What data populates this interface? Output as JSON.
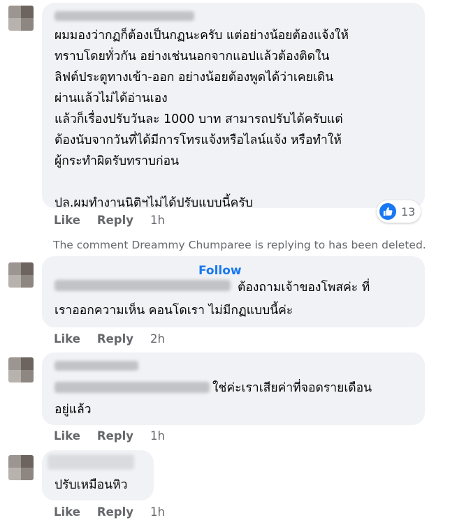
{
  "comments": [
    {
      "text": "ผมมองว่ากฏก็ต้องเป็นกฏนะครับ แต่อย่างน้อยต้องแจ้งให้\nทราบโดยทั่วกัน อย่างเช่นนอกจากแอปแล้วต้องติดใน\nลิฟต์ประตูทางเข้า-ออก อย่างน้อยต้องพูดได้ว่าเคยเดิน\nผ่านแล้วไม่ได้อ่านเอง\nแล้วก็เรื่องปรับวันละ 1000 บาท สามารถปรับได้ครับแต่\nต้องนับจากวันที่ได้มีการโทรแจ้งหรือไลน์แจ้ง หรือทำให้\nผู้กระทำผิดรับทราบก่อน\n\nปล.ผมทำงานนิติฯไม่ได้ปรับแบบนี้ครับ",
      "like_label": "Like",
      "reply_label": "Reply",
      "time": "1h",
      "reaction_count": "13"
    },
    {
      "follow_label": "Follow",
      "text_line1": "ต้องถามเจ้าของโพสค่ะ ที่",
      "text_line2": "เราออกความเห็น คอนโดเรา ไม่มีกฏแบบนี้ค่ะ",
      "like_label": "Like",
      "reply_label": "Reply",
      "time": "2h"
    },
    {
      "text_line1": "ใช่ค่ะเราเสียค่าที่จอดรายเดือน",
      "text_line2": "อยู่แล้ว",
      "like_label": "Like",
      "reply_label": "Reply",
      "time": "1h"
    },
    {
      "text": "ปรับเหมือนหิว",
      "like_label": "Like",
      "reply_label": "Reply",
      "time": "1h"
    }
  ],
  "deleted_note": "The comment Dreammy Chumparee is replying to has been deleted.",
  "colors": {
    "bubble": "#f0f2f5",
    "accent": "#1877f2",
    "meta": "#65676b"
  },
  "icons": {
    "reaction": "like-thumb-icon"
  }
}
